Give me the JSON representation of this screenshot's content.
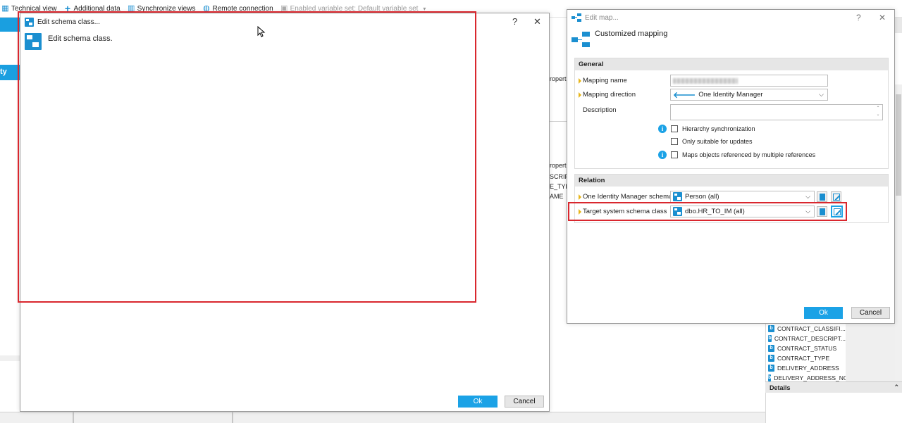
{
  "toolbar": {
    "items": [
      {
        "label": "Technical view",
        "icon": "table-icon"
      },
      {
        "label": "Additional data",
        "icon": "plus-icon"
      },
      {
        "label": "Synchronize views",
        "icon": "sync-icon"
      },
      {
        "label": "Remote connection",
        "icon": "globe-icon"
      },
      {
        "label": "Enabled variable set: Default variable set",
        "icon": "variable-set-icon",
        "disabled": true
      }
    ]
  },
  "background": {
    "selected_nav_text": "ty",
    "mid_fragments": [
      "ropert",
      "ropert",
      "SCRIPT",
      "E_TYPE",
      "AME"
    ],
    "right_list": [
      "CONTRACT_CLASSIFI...",
      "CONTRACT_DESCRIPT...",
      "CONTRACT_STATUS",
      "CONTRACT_TYPE",
      "DELIVERY_ADDRESS",
      "DELIVERY_ADDRESS_NO"
    ],
    "details_label": "Details"
  },
  "schema_dialog": {
    "title": "Edit schema class...",
    "heading": "Edit schema class.",
    "help": "?",
    "close": "✕",
    "ok_label": "Ok",
    "cancel_label": "Cancel"
  },
  "map_dialog": {
    "title": "Edit map...",
    "help": "?",
    "close": "✕",
    "heading": "Customized mapping",
    "general": {
      "header": "General",
      "mapping_name_label": "Mapping name",
      "mapping_direction_label": "Mapping direction",
      "mapping_direction_value": "One Identity Manager",
      "description_label": "Description",
      "hierarchy_sync_label": "Hierarchy synchronization",
      "only_updates_label": "Only suitable for updates",
      "multi_refs_label": "Maps objects referenced by multiple references"
    },
    "relation": {
      "header": "Relation",
      "oim_class_label": "One Identity Manager schema cl...",
      "oim_class_value": "Person (all)",
      "target_class_label": "Target system schema class",
      "target_class_value": "dbo.HR_TO_IM (all)"
    },
    "ok_label": "Ok",
    "cancel_label": "Cancel"
  },
  "colors": {
    "accent": "#1ba2e6",
    "highlight_red": "#d9272e",
    "required_marker": "#e7b518"
  }
}
